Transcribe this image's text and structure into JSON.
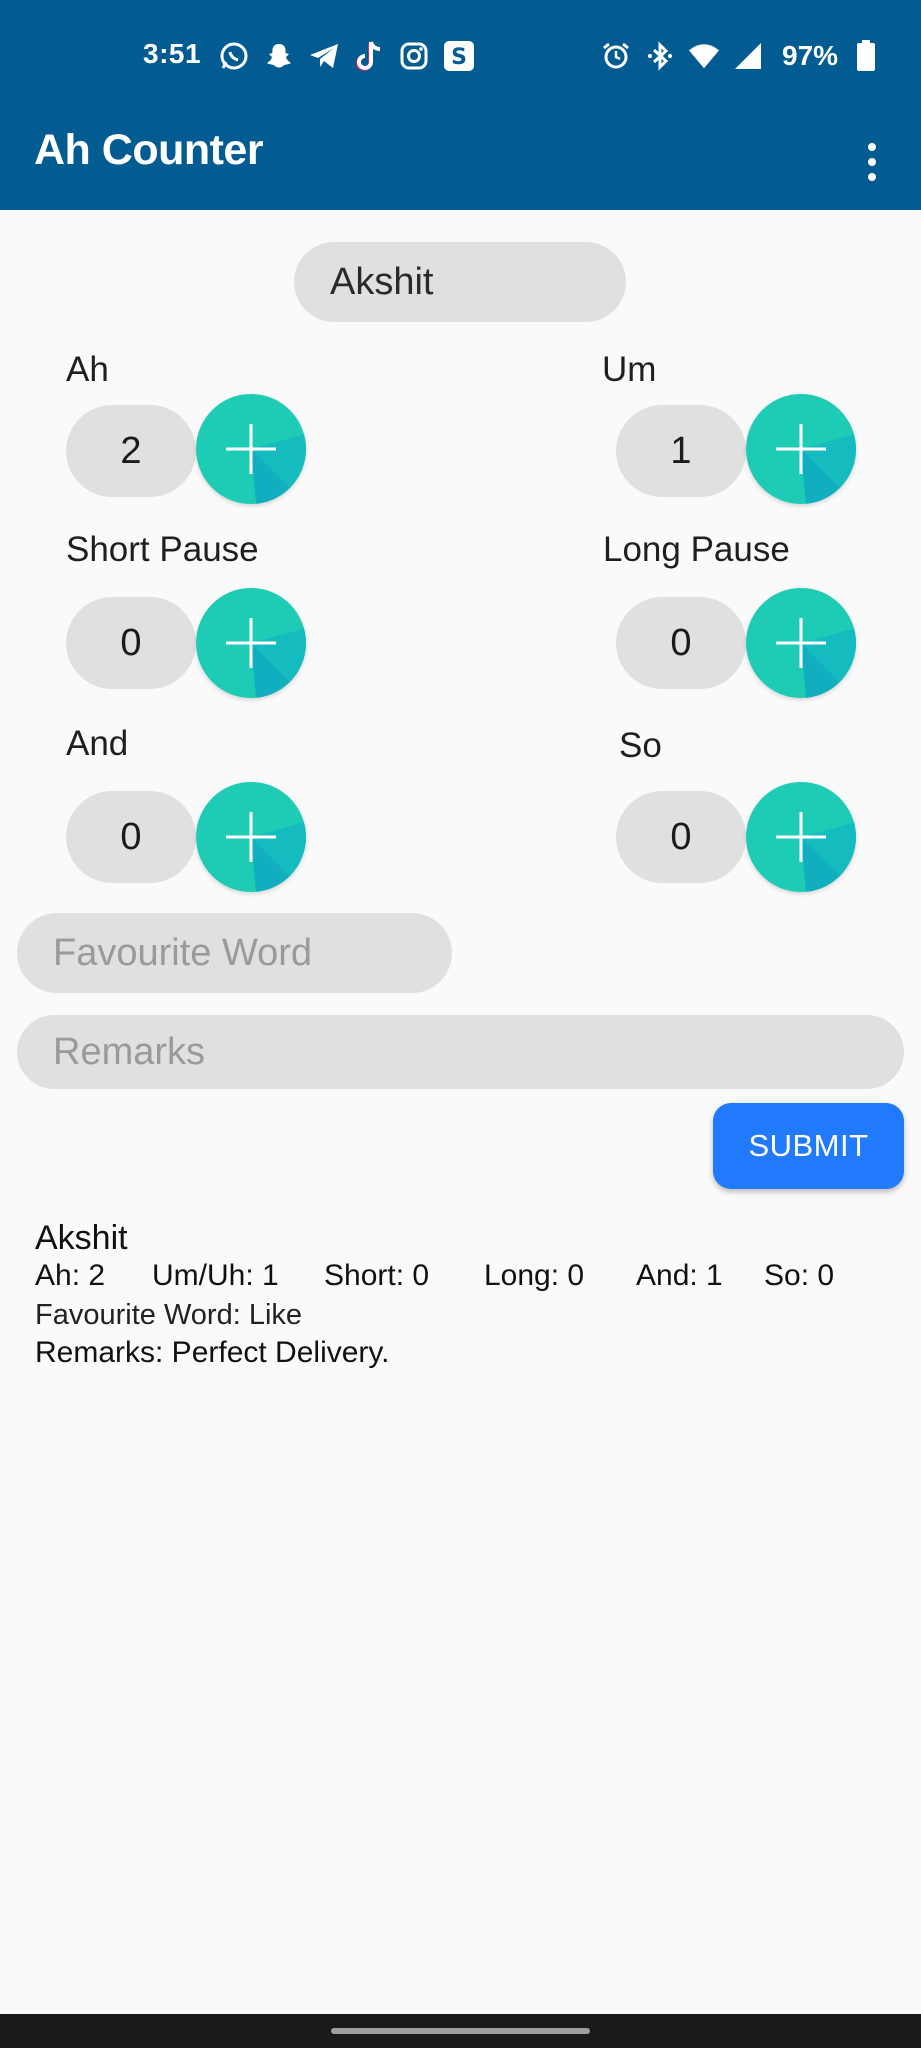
{
  "status_bar": {
    "time": "3:51",
    "battery": "97%",
    "left_icons": [
      "whatsapp-icon",
      "snapchat-icon",
      "telegram-icon",
      "tiktok-icon",
      "instagram-icon",
      "s-app-icon"
    ],
    "right_icons": [
      "alarm-icon",
      "bluetooth-icon",
      "wifi-icon",
      "signal-icon",
      "battery-icon"
    ]
  },
  "app_bar": {
    "title": "Ah Counter",
    "menu_icon": "more-vert-icon"
  },
  "speaker_name": "Akshit",
  "counters": [
    {
      "label": "Ah",
      "value": "2"
    },
    {
      "label": "Um",
      "value": "1"
    },
    {
      "label": "Short Pause",
      "value": "0"
    },
    {
      "label": "Long Pause",
      "value": "0"
    },
    {
      "label": "And",
      "value": "0"
    },
    {
      "label": "So",
      "value": "0"
    }
  ],
  "inputs": {
    "favourite_placeholder": "Favourite Word",
    "remarks_placeholder": "Remarks"
  },
  "submit_label": "SUBMIT",
  "result": {
    "name": "Akshit",
    "stats": [
      "Ah: 2",
      "Um/Uh: 1",
      "Short: 0",
      "Long: 0",
      "And: 1",
      "So: 0"
    ],
    "favourite": "Favourite Word: Like",
    "remarks": "Remarks: Perfect Delivery."
  },
  "colors": {
    "app_bar": "#025c91",
    "plus_button_light": "#1ecbb5",
    "plus_button_dark": "#12b3bd",
    "submit_button": "#2179fb",
    "pill": "#e0e0e0"
  }
}
